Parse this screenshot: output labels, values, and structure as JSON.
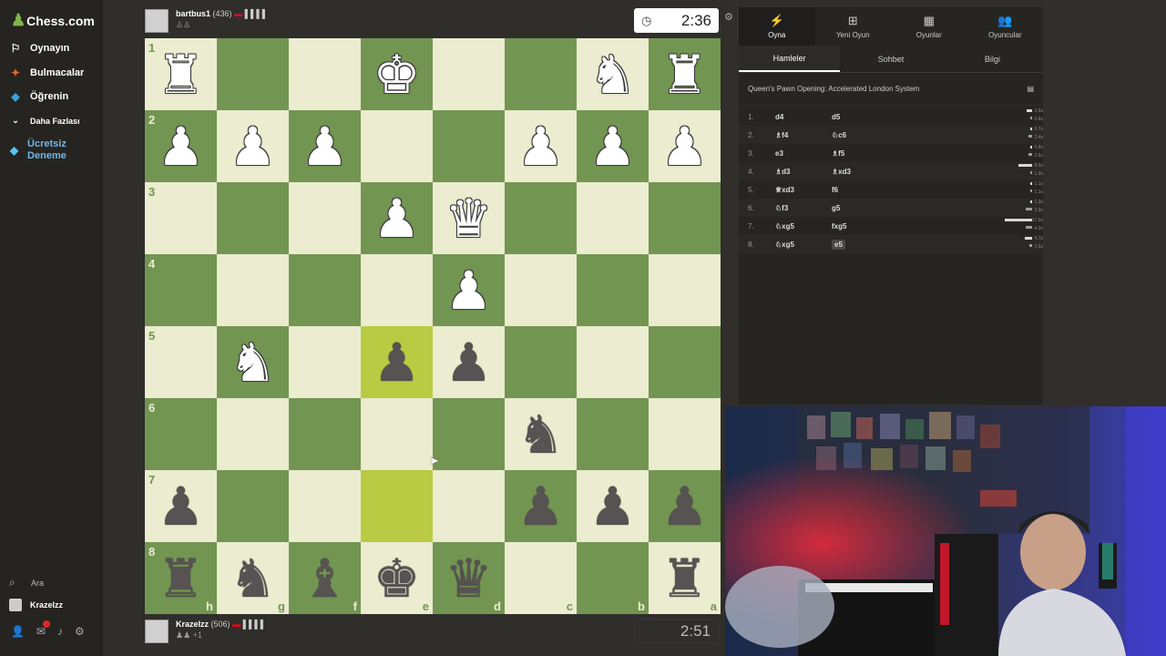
{
  "nav": {
    "logo": "Chess.com",
    "items": [
      {
        "label": "Oynayın",
        "icon": "play-icon"
      },
      {
        "label": "Bulmacalar",
        "icon": "puzzle-icon"
      },
      {
        "label": "Öğrenin",
        "icon": "learn-icon"
      },
      {
        "label": "Daha Fazlası",
        "icon": "chevron-down-icon"
      }
    ],
    "trial": "Ücretsiz Deneme",
    "search": "Ara",
    "user": "Krazelzz"
  },
  "top_player": {
    "name": "bartbus1",
    "rating": "(436)",
    "flag": "NO",
    "clock": "2:36"
  },
  "bottom_player": {
    "name": "Krazelzz",
    "rating": "(506)",
    "flag": "TR",
    "sub": "+1",
    "clock": "2:51"
  },
  "board": {
    "orientation": "black",
    "ranks": [
      "1",
      "2",
      "3",
      "4",
      "5",
      "6",
      "7",
      "8"
    ],
    "files": [
      "h",
      "g",
      "f",
      "e",
      "d",
      "c",
      "b",
      "a"
    ],
    "highlighted": [
      "e5",
      "e7"
    ],
    "pieces": [
      [
        "wR",
        "",
        "",
        "wK",
        "",
        "",
        "wN",
        "wR"
      ],
      [
        "wP",
        "wP",
        "wP",
        "",
        "",
        "wP",
        "wP",
        "wP"
      ],
      [
        "",
        "",
        "",
        "wP",
        "wQ",
        "",
        "",
        ""
      ],
      [
        "",
        "",
        "",
        "",
        "wP",
        "",
        "",
        ""
      ],
      [
        "",
        "wN",
        "",
        "bP",
        "bP",
        "",
        "",
        ""
      ],
      [
        "",
        "",
        "",
        "",
        "",
        "bN",
        "",
        ""
      ],
      [
        "bP",
        "",
        "",
        "",
        "",
        "bP",
        "bP",
        "bP"
      ],
      [
        "bR",
        "bN",
        "bB",
        "bK",
        "bQ",
        "",
        "",
        "bR"
      ]
    ]
  },
  "panel": {
    "top_tabs": [
      {
        "label": "Oyna",
        "icon": "bolt-icon"
      },
      {
        "label": "Yeni Oyun",
        "icon": "plus-icon"
      },
      {
        "label": "Oyunlar",
        "icon": "board-icon"
      },
      {
        "label": "Oyuncular",
        "icon": "players-icon"
      }
    ],
    "sub_tabs": [
      "Hamleler",
      "Sohbet",
      "Bilgi"
    ],
    "opening": "Queen's Pawn Opening: Accelerated London System",
    "moves": [
      {
        "num": "1.",
        "white": "d4",
        "black": "d5",
        "wt": "3.6s",
        "bt": "0.8s",
        "wf": 0.2,
        "bf": 0.05
      },
      {
        "num": "2.",
        "white": "♗f4",
        "black": "♘c6",
        "wt": "0.7s",
        "bt": "2.4s",
        "wf": 0.04,
        "bf": 0.14
      },
      {
        "num": "3.",
        "white": "e3",
        "black": "♗f5",
        "wt": "0.8s",
        "bt": "2.6s",
        "wf": 0.05,
        "bf": 0.15
      },
      {
        "num": "4.",
        "white": "♗d3",
        "black": "♗xd3",
        "wt": "8.5s",
        "bt": "1.0s",
        "wf": 0.5,
        "bf": 0.06
      },
      {
        "num": "5.",
        "white": "♕xd3",
        "black": "f6",
        "wt": "1.1s",
        "bt": "1.1s",
        "wf": 0.07,
        "bf": 0.07
      },
      {
        "num": "6.",
        "white": "♘f3",
        "black": "g5",
        "wt": "1.3s",
        "bt": "3.9s",
        "wf": 0.08,
        "bf": 0.23
      },
      {
        "num": "7.",
        "white": "♘xg5",
        "black": "fxg5",
        "wt": "17.5s",
        "bt": "4.2s",
        "wf": 1.0,
        "bf": 0.25
      },
      {
        "num": "8.",
        "white": "♘xg5",
        "black": "e5",
        "wt": "4.7s",
        "bt": "1.6s",
        "wf": 0.28,
        "bf": 0.1
      }
    ]
  },
  "colors": {
    "light": "#ebecd0",
    "dark": "#739552",
    "hl_light": "#f5f682",
    "hl_dark": "#b9ca43",
    "accent": "#81b64c"
  }
}
